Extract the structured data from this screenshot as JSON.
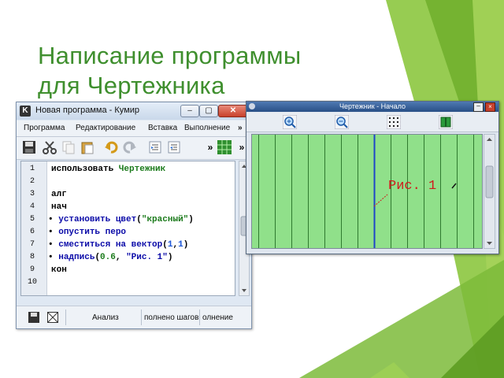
{
  "slide": {
    "title_line1": "Написание программы",
    "title_line2": "для Чертежника"
  },
  "kumir_window": {
    "title": "Новая программа - Кумир",
    "menu": [
      "Программа",
      "Редактирование",
      "Вставка",
      "Выполнение"
    ],
    "menu_more": "»",
    "toolbar_more1": "»",
    "toolbar_more2": "»",
    "line_numbers": [
      "1",
      "2",
      "3",
      "4",
      "5",
      "6",
      "7",
      "8",
      "9",
      "10"
    ],
    "code": {
      "l1_kw": "использовать",
      "l1_name": "Чертежник",
      "l3": "алг",
      "l4": "нач",
      "bullet": "•",
      "l5_fn": "установить цвет",
      "l5_open": "(",
      "l5_str": "\"красный\"",
      "l5_close": ")",
      "l6_fn": "опустить перо",
      "l7_fn": "сместиться на вектор",
      "l7_open": "(",
      "l7_a": "1",
      "l7_comma": ",",
      "l7_b": "1",
      "l7_close": ")",
      "l8_fn": "надпись",
      "l8_open": "(",
      "l8_num": "0.6",
      "l8_comma": ", ",
      "l8_str": "\"Рис. 1\"",
      "l8_close": ")",
      "l9": "кон"
    },
    "status": {
      "analysis": "Анализ",
      "steps": "полнено шагов",
      "execution": "олнение"
    }
  },
  "drawer_window": {
    "title": "Чертежник - Начало",
    "canvas_label": "Рис. 1",
    "colors": {
      "canvas_bg": "#90e08a",
      "grid": "#2f7a2f",
      "axis": "#1e44c8",
      "label": "#d01c1c"
    }
  },
  "colors": {
    "title_green": "#3f8f2e",
    "deco_green": "#7dbb3a"
  }
}
